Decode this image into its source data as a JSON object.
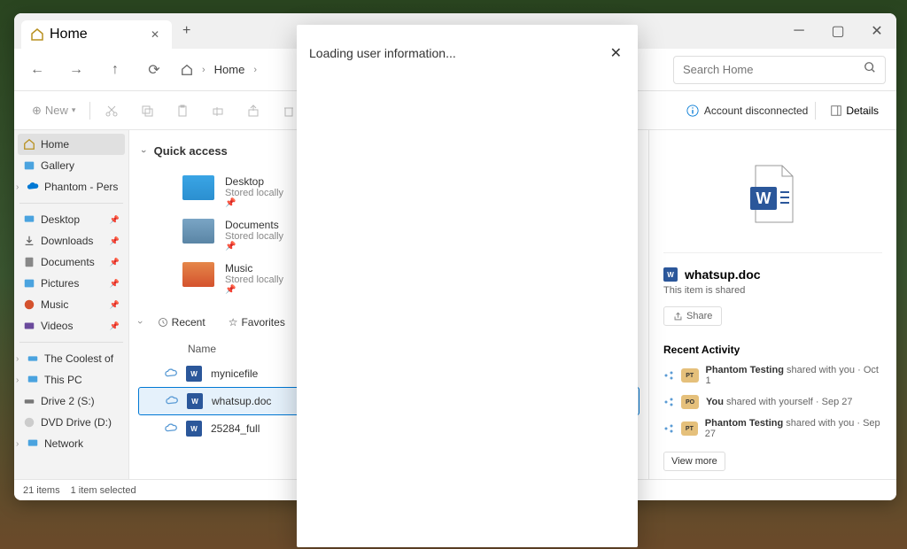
{
  "titlebar": {
    "tab_label": "Home"
  },
  "toolbar": {
    "breadcrumb": "Home",
    "search_placeholder": "Search Home",
    "new_label": "New"
  },
  "account": {
    "status": "Account disconnected",
    "details": "Details"
  },
  "nav": {
    "home": "Home",
    "gallery": "Gallery",
    "phantom": "Phantom - Pers",
    "desktop": "Desktop",
    "downloads": "Downloads",
    "documents": "Documents",
    "pictures": "Pictures",
    "music": "Music",
    "videos": "Videos",
    "coolest": "The Coolest of",
    "thispc": "This PC",
    "drive2": "Drive 2 (S:)",
    "dvd": "DVD Drive (D:)",
    "network": "Network"
  },
  "main": {
    "quick_access": "Quick access",
    "qa": {
      "desktop": {
        "title": "Desktop",
        "sub": "Stored locally"
      },
      "documents": {
        "title": "Documents",
        "sub": "Stored locally"
      },
      "music": {
        "title": "Music",
        "sub": "Stored locally"
      }
    },
    "recent": "Recent",
    "favorites": "Favorites",
    "col_name": "Name",
    "files": {
      "f1": "mynicefile",
      "f2": "whatsup.doc",
      "f3": "25284_full"
    }
  },
  "details": {
    "filename": "whatsup.doc",
    "shared_text": "This item is shared",
    "share_btn": "Share",
    "recent_activity": "Recent Activity",
    "activity": {
      "a1": {
        "avatar": "PT",
        "user": "Phantom Testing",
        "action": "shared with you",
        "date": "Oct 1"
      },
      "a2": {
        "avatar": "PO",
        "user": "You",
        "action": "shared with yourself",
        "date": "Sep 27"
      },
      "a3": {
        "avatar": "PT",
        "user": "Phantom Testing",
        "action": "shared with you",
        "date": "Sep 27"
      }
    },
    "view_more": "View more"
  },
  "status": {
    "items": "21 items",
    "selected": "1 item selected"
  },
  "dialog": {
    "title": "Loading user information..."
  }
}
